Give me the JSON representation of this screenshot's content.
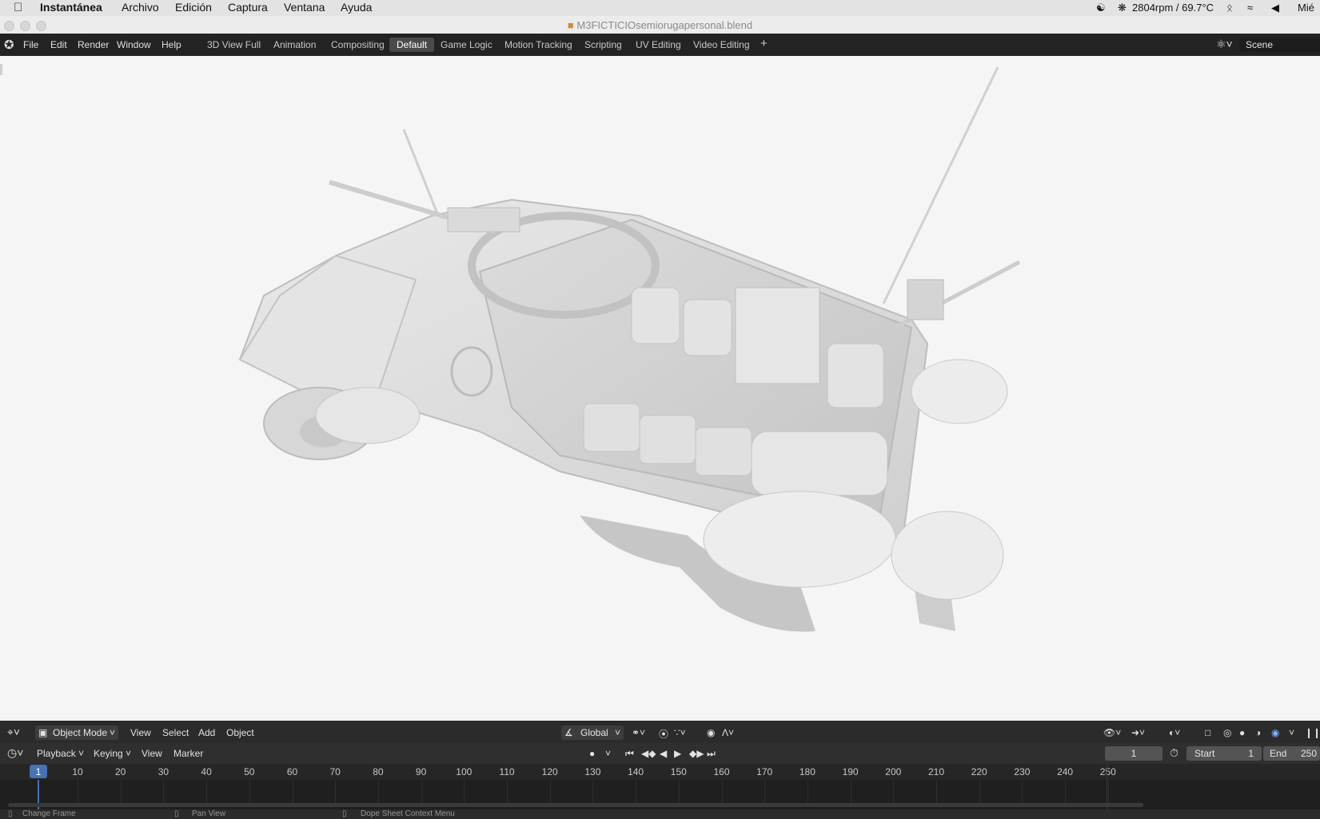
{
  "macbar": {
    "app": "Instantánea",
    "menus": [
      "Archivo",
      "Edición",
      "Captura",
      "Ventana",
      "Ayuda"
    ],
    "fan_status": "2804rpm / 69.7°C",
    "day": "Mié"
  },
  "window": {
    "title": "M3FICTICIOsemiorugapersonal.blend"
  },
  "topbar": {
    "menus": [
      "File",
      "Edit",
      "Render",
      "Window",
      "Help"
    ],
    "workspaces": [
      "3D View Full",
      "Animation",
      "Compositing",
      "Default",
      "Game Logic",
      "Motion Tracking",
      "Scripting",
      "UV Editing",
      "Video Editing"
    ],
    "active_workspace": "Default",
    "add_symbol": "+",
    "scene": "Scene"
  },
  "header3d": {
    "mode": "Object Mode",
    "menus": [
      "View",
      "Select",
      "Add",
      "Object"
    ],
    "transform_orientation": "Global"
  },
  "timeline": {
    "menus": [
      "Playback",
      "Keying",
      "View",
      "Marker"
    ],
    "current_frame": "1",
    "start_label": "Start",
    "start_value": "1",
    "end_label": "End",
    "end_value": "250",
    "ruler_first": "1",
    "ruler_ticks": [
      "10",
      "20",
      "30",
      "40",
      "50",
      "60",
      "70",
      "80",
      "90",
      "100",
      "110",
      "120",
      "130",
      "140",
      "150",
      "160",
      "170",
      "180",
      "190",
      "200",
      "210",
      "220",
      "230",
      "240",
      "250"
    ]
  },
  "status": {
    "items": [
      "Change Frame",
      "Pan View",
      "Dope Sheet Context Menu"
    ]
  }
}
